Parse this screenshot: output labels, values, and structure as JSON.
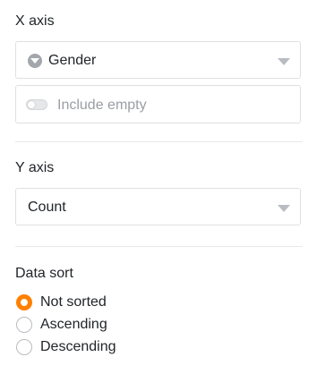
{
  "x_axis": {
    "label": "X axis",
    "field": {
      "value": "Gender",
      "icon": "single-select-field-icon"
    },
    "include_empty": {
      "label": "Include empty",
      "enabled": false
    }
  },
  "y_axis": {
    "label": "Y axis",
    "value": "Count"
  },
  "data_sort": {
    "label": "Data sort",
    "options": [
      {
        "label": "Not sorted",
        "selected": true
      },
      {
        "label": "Ascending",
        "selected": false
      },
      {
        "label": "Descending",
        "selected": false
      }
    ]
  },
  "colors": {
    "accent": "#ff8000",
    "border": "#dfe0e2",
    "muted_text": "#9a9ea3"
  }
}
